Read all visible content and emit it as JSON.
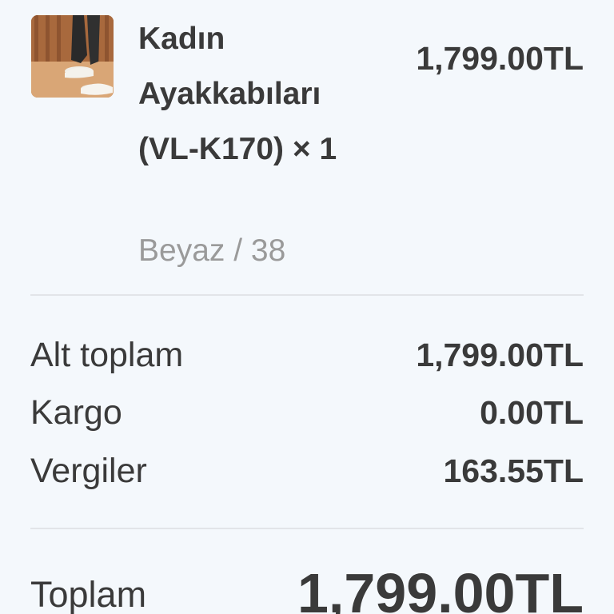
{
  "product": {
    "name": "Kadın Ayakkabıları (VL-K170) × 1",
    "variant": "Beyaz / 38",
    "price": "1,799.00TL",
    "image_icon": "shoe-photo"
  },
  "summary": {
    "subtotal_label": "Alt toplam",
    "subtotal_value": "1,799.00TL",
    "shipping_label": "Kargo",
    "shipping_value": "0.00TL",
    "taxes_label": "Vergiler",
    "taxes_value": "163.55TL",
    "total_label": "Toplam",
    "total_value": "1,799.00TL"
  },
  "colors": {
    "background": "#f4f8fc",
    "text": "#3a3a3a",
    "muted_text": "#9a9a9a",
    "divider": "#e2e4e8"
  }
}
